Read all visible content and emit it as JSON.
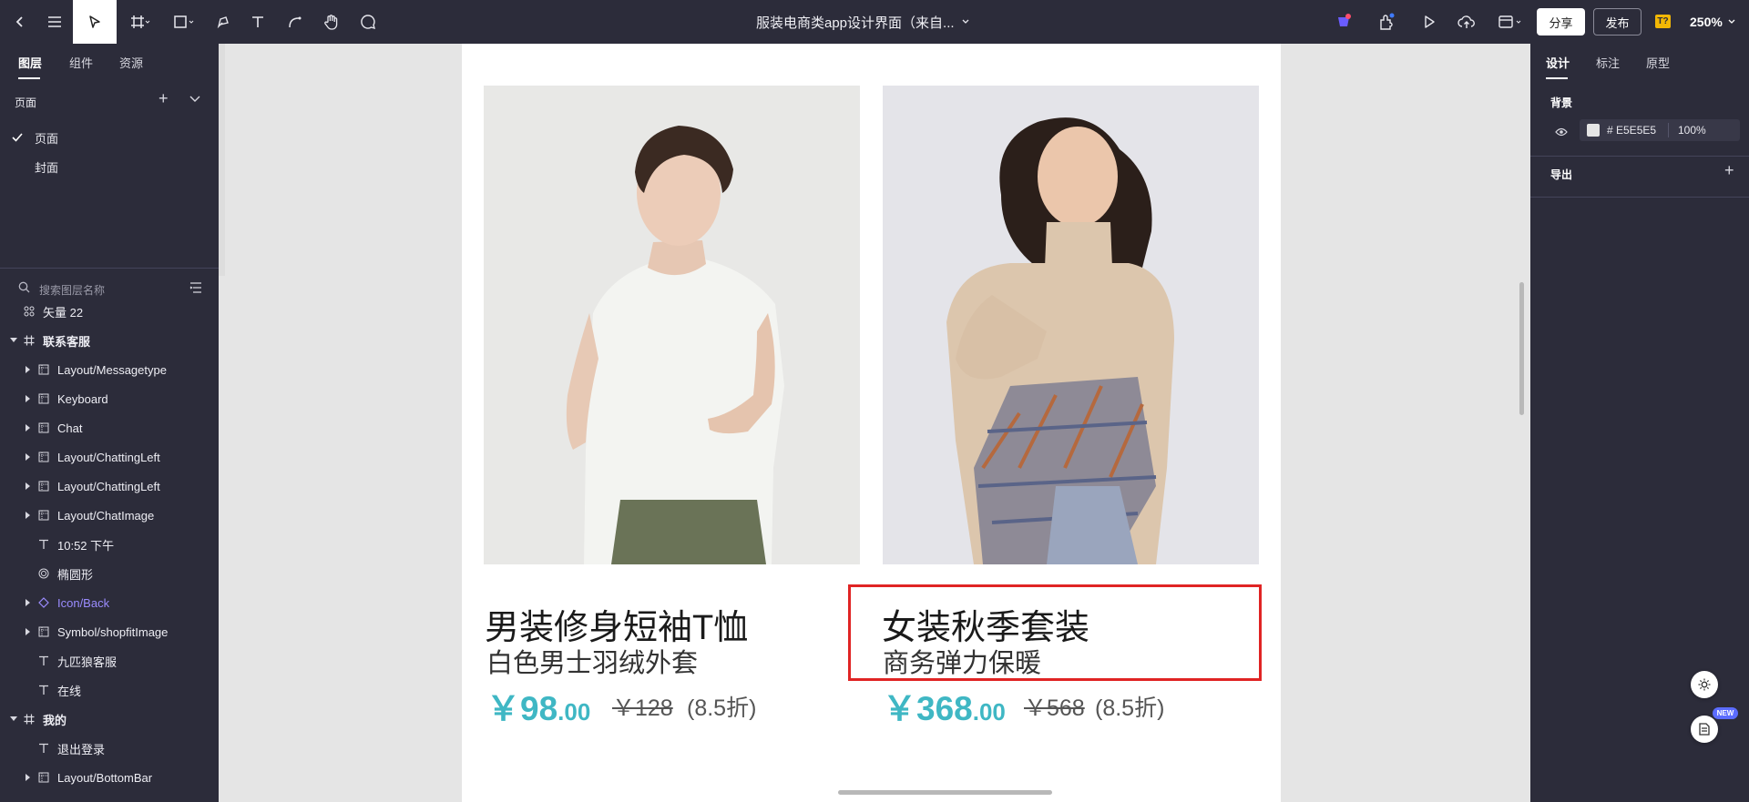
{
  "toolbar": {
    "document_title": "服装电商类app设计界面（来自...",
    "share_label": "分享",
    "publish_label": "发布",
    "badge_text": "T?",
    "zoom_level": "250%"
  },
  "left_panel": {
    "tabs": [
      "图层",
      "组件",
      "资源"
    ],
    "pages_header": "页面",
    "pages": [
      {
        "label": "页面",
        "selected": true
      },
      {
        "label": "封面",
        "selected": false
      }
    ],
    "search_placeholder": "搜索图层名称",
    "layers": [
      {
        "label": "矢量 22",
        "icon": "vector-icon",
        "depth": 0,
        "expandable": false
      },
      {
        "label": "联系客服",
        "icon": "frame-icon",
        "depth": 0,
        "expandable": true,
        "expanded": true,
        "bold": true
      },
      {
        "label": "Layout/Messagetype",
        "icon": "component-icon",
        "depth": 1,
        "expandable": true
      },
      {
        "label": "Keyboard",
        "icon": "component-icon",
        "depth": 1,
        "expandable": true
      },
      {
        "label": "Chat",
        "icon": "component-icon",
        "depth": 1,
        "expandable": true
      },
      {
        "label": "Layout/ChattingLeft",
        "icon": "component-icon",
        "depth": 1,
        "expandable": true
      },
      {
        "label": "Layout/ChattingLeft",
        "icon": "component-icon",
        "depth": 1,
        "expandable": true
      },
      {
        "label": "Layout/ChatImage",
        "icon": "component-icon",
        "depth": 1,
        "expandable": true
      },
      {
        "label": "10:52 下午",
        "icon": "text-icon",
        "depth": 1,
        "expandable": false
      },
      {
        "label": "椭圆形",
        "icon": "ellipse-icon",
        "depth": 1,
        "expandable": false
      },
      {
        "label": "Icon/Back",
        "icon": "instance-icon",
        "depth": 1,
        "expandable": true,
        "purple": true
      },
      {
        "label": "Symbol/shopfitImage",
        "icon": "component-icon",
        "depth": 1,
        "expandable": true
      },
      {
        "label": "九匹狼客服",
        "icon": "text-icon",
        "depth": 1,
        "expandable": false
      },
      {
        "label": "在线",
        "icon": "text-icon",
        "depth": 1,
        "expandable": false
      },
      {
        "label": "我的",
        "icon": "frame-icon",
        "depth": 0,
        "expandable": true,
        "expanded": true,
        "bold": true
      },
      {
        "label": "退出登录",
        "icon": "text-icon",
        "depth": 1,
        "expandable": false
      },
      {
        "label": "Layout/BottomBar",
        "icon": "component-icon",
        "depth": 1,
        "expandable": true
      }
    ]
  },
  "canvas": {
    "products": [
      {
        "title": "男装修身短袖T恤",
        "subtitle": "白色男士羽绒外套",
        "price_int": "￥98",
        "price_dec": ".00",
        "old_price": "￥128",
        "discount": "(8.5折)"
      },
      {
        "title": "女装秋季套装",
        "subtitle": "商务弹力保暖",
        "price_int": "￥368",
        "price_dec": ".00",
        "old_price": "￥568",
        "discount": "(8.5折)"
      }
    ]
  },
  "right_panel": {
    "tabs": [
      "设计",
      "标注",
      "原型"
    ],
    "background_label": "背景",
    "background_hex": "# E5E5E5",
    "background_opacity": "100%",
    "export_label": "导出"
  },
  "floating": {
    "new_badge": "NEW"
  },
  "colors": {
    "panel_bg": "#2c2c3a",
    "canvas_bg": "#e5e5e5",
    "price_accent": "#3fb7c4",
    "highlight_border": "#e02424"
  }
}
